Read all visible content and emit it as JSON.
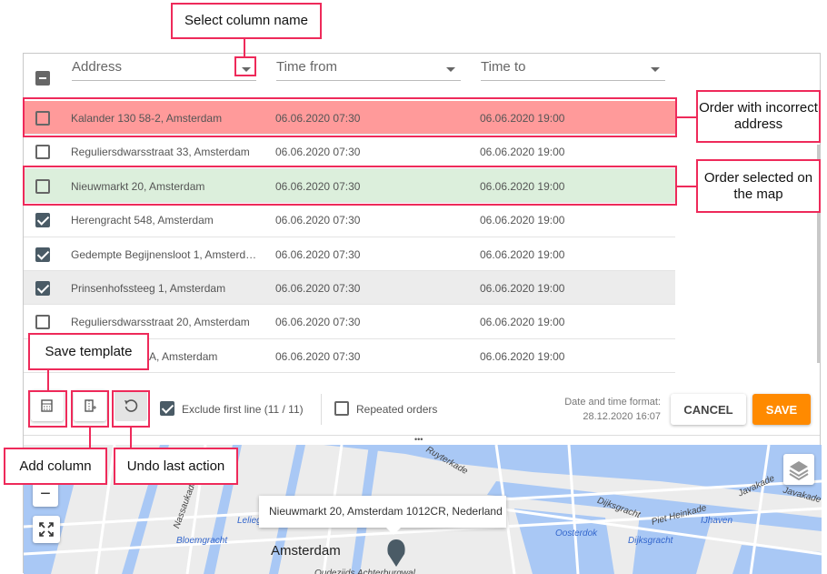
{
  "columns": [
    {
      "label": "Address"
    },
    {
      "label": "Time from"
    },
    {
      "label": "Time to"
    }
  ],
  "rows": [
    {
      "address": "Kalander 130 58-2, Amsterdam",
      "from": "06.06.2020 07:30",
      "to": "06.06.2020 19:00",
      "checked": false,
      "state": "error"
    },
    {
      "address": "Reguliersdwarsstraat 33, Amsterdam",
      "from": "06.06.2020 07:30",
      "to": "06.06.2020 19:00",
      "checked": false,
      "state": ""
    },
    {
      "address": "Nieuwmarkt 20, Amsterdam",
      "from": "06.06.2020 07:30",
      "to": "06.06.2020 19:00",
      "checked": false,
      "state": "selected"
    },
    {
      "address": "Herengracht 548, Amsterdam",
      "from": "06.06.2020 07:30",
      "to": "06.06.2020 19:00",
      "checked": true,
      "state": ""
    },
    {
      "address": "Gedempte Begijnensloot 1, Amsterd…",
      "from": "06.06.2020 07:30",
      "to": "06.06.2020 19:00",
      "checked": true,
      "state": ""
    },
    {
      "address": "Prinsenhofssteeg 1, Amsterdam",
      "from": "06.06.2020 07:30",
      "to": "06.06.2020 19:00",
      "checked": true,
      "state": "hover"
    },
    {
      "address": "Reguliersdwarsstraat 20, Amsterdam",
      "from": "06.06.2020 07:30",
      "to": "06.06.2020 19:00",
      "checked": false,
      "state": ""
    },
    {
      "address": "A, Amsterdam",
      "from": "06.06.2020 07:30",
      "to": "06.06.2020 19:00",
      "checked": false,
      "state": ""
    }
  ],
  "toolbar": {
    "exclude_label": "Exclude first line (11 / 11)",
    "exclude_checked": true,
    "repeated_label": "Repeated orders",
    "repeated_checked": false,
    "format_label": "Date and time format:",
    "format_value": "28.12.2020 16:07",
    "cancel": "CANCEL",
    "save": "SAVE"
  },
  "map": {
    "popup": "Nieuwmarkt 20, Amsterdam 1012CR, Nederland",
    "city": "Amsterdam",
    "labels": [
      "Ruyterkade",
      "Nassaukade",
      "Leliegr",
      "Bloemgracht",
      "Oosterdok",
      "Dijksgracht",
      "Dijksgracht",
      "Piet Heinkade",
      "IJhaven",
      "Javakade",
      "Javakade",
      "Oudezijds Achterburgwal"
    ],
    "zoom_out": "−"
  },
  "callouts": {
    "select_column": "Select column name",
    "incorrect": "Order with incorrect address",
    "selected": "Order selected on the map",
    "save_template": "Save template",
    "add_column": "Add column",
    "undo": "Undo last action"
  },
  "colors": {
    "error_row": "#ff9a9a",
    "selected_row": "#dcefdc",
    "hover_row": "#ececec",
    "save": "#ff8a00",
    "callout": "#ee2a5a",
    "water": "#a9c8f5"
  }
}
